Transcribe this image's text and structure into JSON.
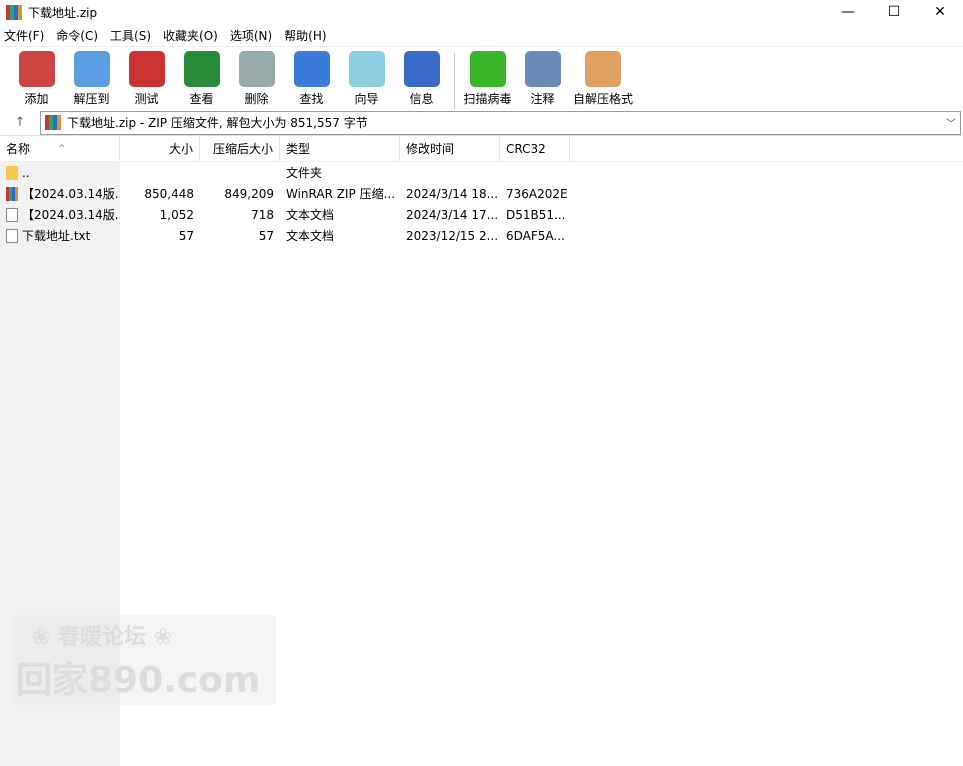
{
  "window": {
    "title": "下载地址.zip",
    "minimize": "—",
    "maximize": "☐",
    "close": "✕"
  },
  "menu": [
    "文件(F)",
    "命令(C)",
    "工具(S)",
    "收藏夹(O)",
    "选项(N)",
    "帮助(H)"
  ],
  "toolbar": [
    {
      "label": "添加",
      "icon": "add-archive-icon",
      "color": "#c44"
    },
    {
      "label": "解压到",
      "icon": "extract-folder-icon",
      "color": "#5aa0e0"
    },
    {
      "label": "测试",
      "icon": "test-clipboard-icon",
      "color": "#c33"
    },
    {
      "label": "查看",
      "icon": "view-book-icon",
      "color": "#2a8a3a"
    },
    {
      "label": "删除",
      "icon": "delete-trash-icon",
      "color": "#9aa"
    },
    {
      "label": "查找",
      "icon": "find-magnifier-icon",
      "color": "#3a7ad8"
    },
    {
      "label": "向导",
      "icon": "wizard-wand-icon",
      "color": "#8ccfe0"
    },
    {
      "label": "信息",
      "icon": "info-icon",
      "color": "#3a6ac8"
    },
    {
      "label": "扫描病毒",
      "icon": "virus-scan-icon",
      "color": "#3bb52a"
    },
    {
      "label": "注释",
      "icon": "comment-icon",
      "color": "#6a8ab8"
    },
    {
      "label": "自解压格式",
      "icon": "sfx-box-icon",
      "color": "#e0a060"
    }
  ],
  "address": {
    "up": "↑",
    "text": "下载地址.zip - ZIP 压缩文件, 解包大小为 851,557 字节",
    "chevron": "﹀"
  },
  "columns": [
    "名称",
    "大小",
    "压缩后大小",
    "类型",
    "修改时间",
    "CRC32"
  ],
  "sort_indicator": "^",
  "rows": [
    {
      "name": "..",
      "size": "",
      "packed": "",
      "type": "文件夹",
      "modified": "",
      "crc": "",
      "icon": "folder"
    },
    {
      "name": "【2024.03.14版...",
      "size": "850,448",
      "packed": "849,209",
      "type": "WinRAR ZIP 压缩...",
      "modified": "2024/3/14 18...",
      "crc": "736A202E",
      "icon": "rar"
    },
    {
      "name": "【2024.03.14版...",
      "size": "1,052",
      "packed": "718",
      "type": "文本文档",
      "modified": "2024/3/14 17...",
      "crc": "D51B51...",
      "icon": "txt"
    },
    {
      "name": "下载地址.txt",
      "size": "57",
      "packed": "57",
      "type": "文本文档",
      "modified": "2023/12/15 2...",
      "crc": "6DAF5A...",
      "icon": "txt"
    }
  ],
  "watermark": {
    "line1": "春暖论坛",
    "line2": "回家890.com"
  }
}
